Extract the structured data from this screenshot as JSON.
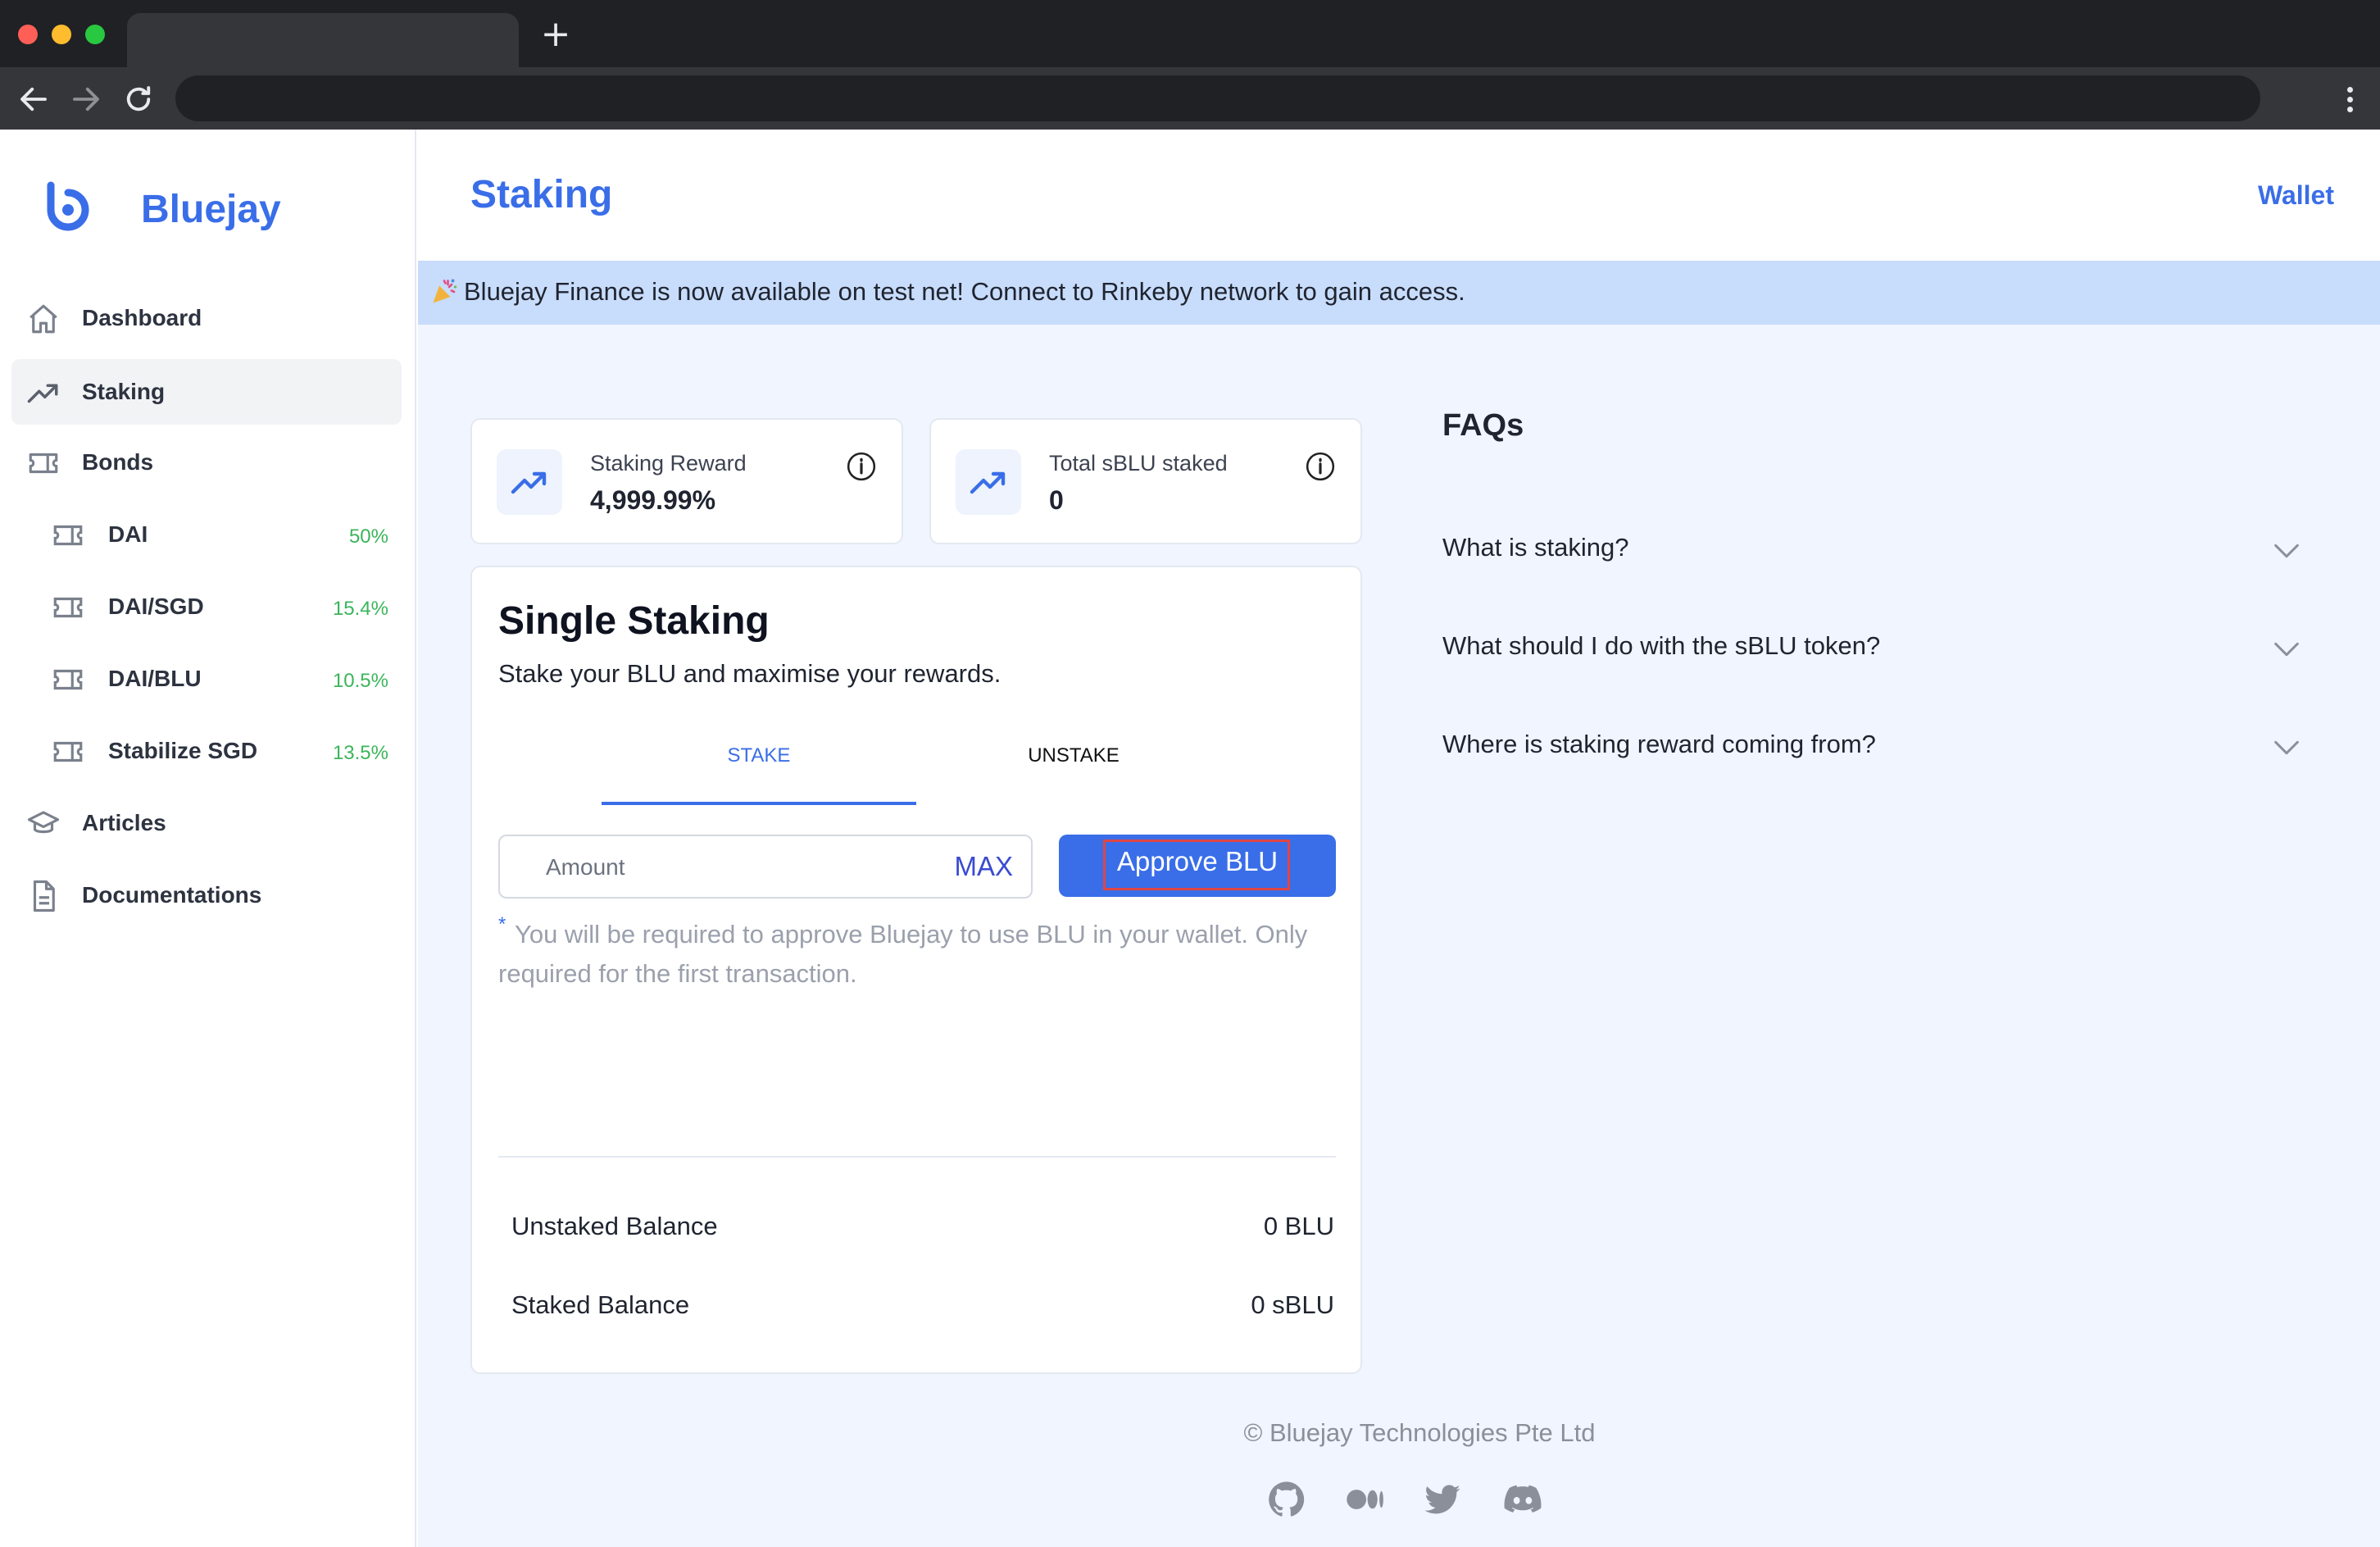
{
  "app": {
    "name": "Bluejay"
  },
  "sidebar": {
    "items": [
      {
        "label": "Dashboard",
        "icon": "home-icon"
      },
      {
        "label": "Staking",
        "icon": "trending-up-icon"
      },
      {
        "label": "Bonds",
        "icon": "ticket-icon"
      }
    ],
    "bonds": [
      {
        "label": "DAI",
        "rate": "50%"
      },
      {
        "label": "DAI/SGD",
        "rate": "15.4%"
      },
      {
        "label": "DAI/BLU",
        "rate": "10.5%"
      },
      {
        "label": "Stabilize SGD",
        "rate": "13.5%"
      }
    ],
    "bottom": [
      {
        "label": "Articles",
        "icon": "graduation-cap-icon"
      },
      {
        "label": "Documentations",
        "icon": "document-icon"
      }
    ]
  },
  "header": {
    "title": "Staking",
    "wallet_label": "Wallet"
  },
  "banner": {
    "emoji": "party-popper-icon",
    "text": "Bluejay Finance is now available on test net! Connect to Rinkeby network to gain access."
  },
  "stats": [
    {
      "label": "Staking Reward",
      "value": "4,999.99%"
    },
    {
      "label": "Total sBLU staked",
      "value": "0"
    }
  ],
  "staking": {
    "title": "Single Staking",
    "subtitle": "Stake your BLU and maximise your rewards.",
    "tabs": [
      "STAKE",
      "UNSTAKE"
    ],
    "active_tab": "STAKE",
    "amount_placeholder": "Amount",
    "max_label": "MAX",
    "approve_label": "Approve BLU",
    "note_star": "*",
    "note": "You will be required to approve Bluejay to use BLU in your wallet. Only required for the first transaction.",
    "balances": [
      {
        "label": "Unstaked Balance",
        "value": "0 BLU"
      },
      {
        "label": "Staked Balance",
        "value": "0 sBLU"
      }
    ]
  },
  "faq": {
    "title": "FAQs",
    "questions": [
      "What is staking?",
      "What should I do with the sBLU token?",
      "Where is staking reward coming from?"
    ]
  },
  "footer": {
    "copyright": "© Bluejay Technologies Pte Ltd",
    "social": [
      "github-icon",
      "medium-icon",
      "twitter-icon",
      "discord-icon"
    ]
  },
  "colors": {
    "brand": "#3a6ee8",
    "banner": "#c8dcfb",
    "positive": "#3bb55b",
    "background": "#f0f5ff"
  }
}
